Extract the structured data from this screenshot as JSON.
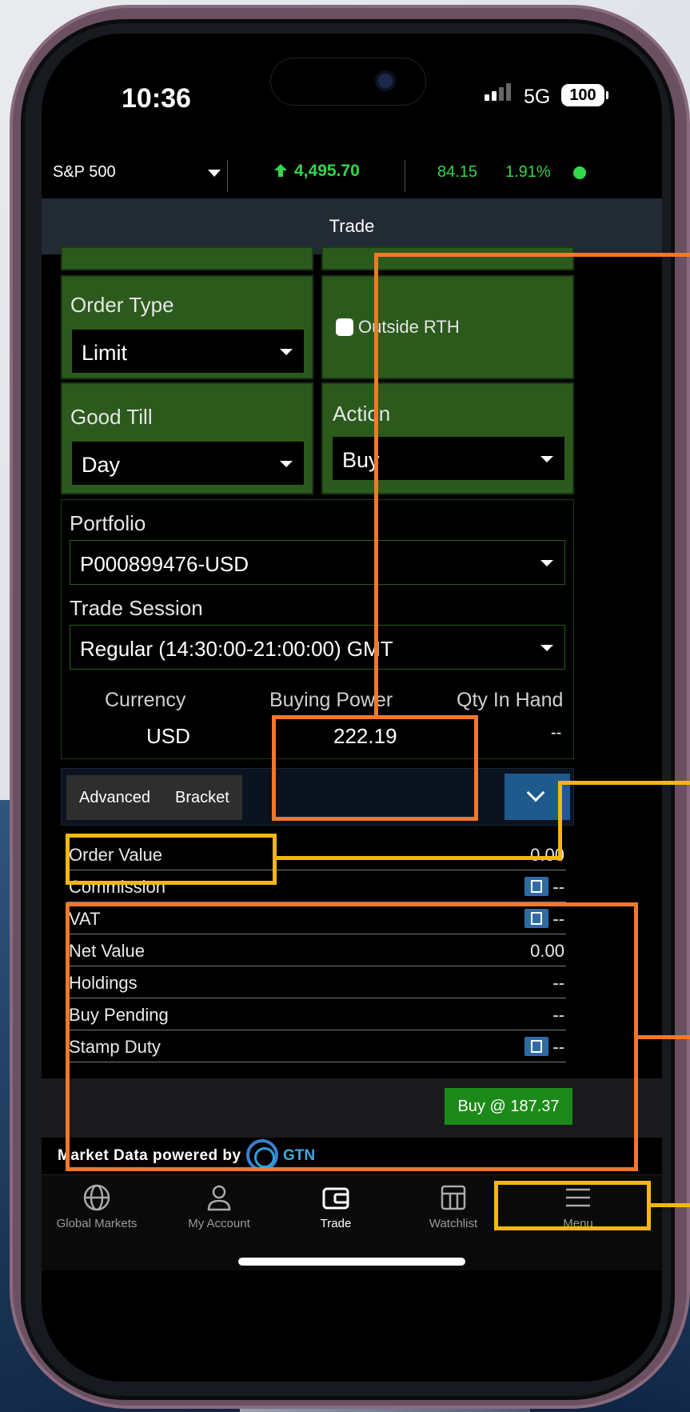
{
  "status_bar": {
    "time": "10:36",
    "network": "5G",
    "battery": "100"
  },
  "ticker": {
    "index": "S&P 500",
    "price": "4,495.70",
    "change": "84.15",
    "change_pct": "1.91%",
    "status_color": "#32d74b"
  },
  "header": {
    "title": "Trade"
  },
  "order_form": {
    "order_type": {
      "label": "Order Type",
      "value": "Limit"
    },
    "outside_rth": {
      "label": "Outside RTH",
      "checked": false
    },
    "good_till": {
      "label": "Good Till",
      "value": "Day"
    },
    "action": {
      "label": "Action",
      "value": "Buy"
    },
    "portfolio": {
      "label": "Portfolio",
      "value": "P000899476-USD"
    },
    "trade_session": {
      "label": "Trade Session",
      "value": "Regular (14:30:00-21:00:00) GMT"
    },
    "currency": {
      "label": "Currency",
      "value": "USD"
    },
    "buying_power": {
      "label": "Buying Power",
      "value": "222.19"
    },
    "qty_in_hand": {
      "label": "Qty In Hand",
      "value": "--"
    }
  },
  "tabs": {
    "advanced": "Advanced",
    "bracket": "Bracket"
  },
  "summary": [
    {
      "label": "Order Value",
      "value": "0.00",
      "calc": false
    },
    {
      "label": "Commission",
      "value": "--",
      "calc": true
    },
    {
      "label": "VAT",
      "value": "--",
      "calc": true
    },
    {
      "label": "Net Value",
      "value": "0.00",
      "calc": false
    },
    {
      "label": "Holdings",
      "value": "--",
      "calc": false
    },
    {
      "label": "Buy Pending",
      "value": "--",
      "calc": false
    },
    {
      "label": "Stamp Duty",
      "value": "--",
      "calc": true
    }
  ],
  "buy_button": "Buy @ 187.37",
  "footer": {
    "powered_by": "Market Data powered by",
    "provider": "GTN"
  },
  "tabbar": [
    {
      "label": "Global Markets",
      "icon": "globe-icon"
    },
    {
      "label": "My Account",
      "icon": "person-icon"
    },
    {
      "label": "Trade",
      "icon": "wallet-icon",
      "active": true
    },
    {
      "label": "Watchlist",
      "icon": "grid-icon"
    },
    {
      "label": "Menu",
      "icon": "hamburger-icon"
    }
  ],
  "colors": {
    "accent_green": "#2c5a1d",
    "buy_green": "#1c8a18",
    "annotation_orange": "#f2782a",
    "annotation_yellow": "#f5b70f"
  }
}
